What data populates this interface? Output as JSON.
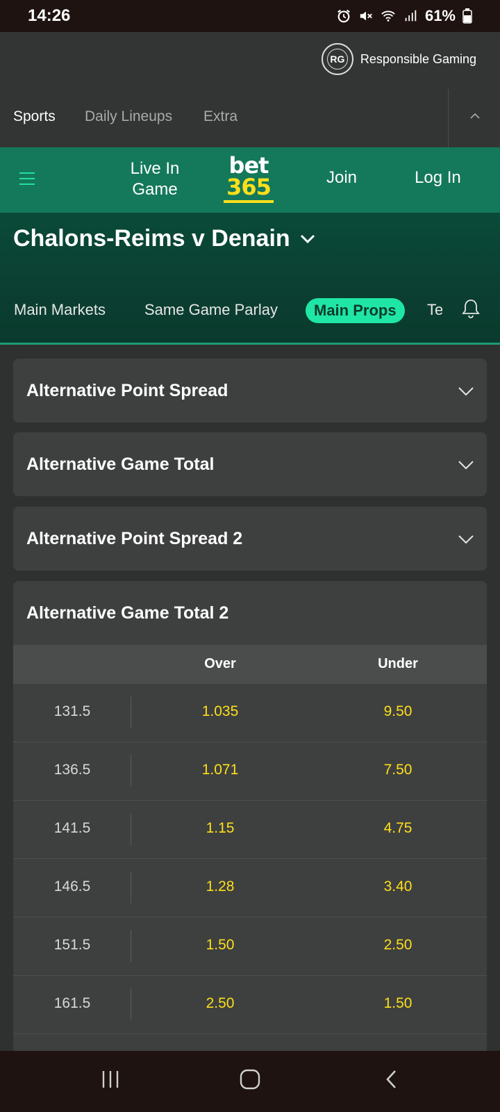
{
  "status_bar": {
    "time": "14:26",
    "battery": "61%",
    "icons": [
      "alarm-icon",
      "mute-icon",
      "wifi-icon",
      "signal-icon",
      "battery-icon"
    ]
  },
  "header": {
    "responsible_gaming": {
      "badge": "RG",
      "label": "Responsible Gaming"
    },
    "nav": [
      "Sports",
      "Daily Lineups",
      "Extra"
    ]
  },
  "green_bar": {
    "live_in_game": "Live In Game",
    "logo_top": "bet",
    "logo_bottom": "365",
    "join": "Join",
    "login": "Log In"
  },
  "match": {
    "title": "Chalons-Reims v Denain",
    "tabs": [
      "Main Markets",
      "Same Game Parlay",
      "Main Props",
      "Te"
    ],
    "active_tab": "Main Props"
  },
  "markets": [
    {
      "title": "Alternative Point Spread",
      "expanded": false
    },
    {
      "title": "Alternative Game Total",
      "expanded": false
    },
    {
      "title": "Alternative Point Spread 2",
      "expanded": false
    },
    {
      "title": "Alternative Game Total 2",
      "expanded": true
    }
  ],
  "total_table": {
    "headers": [
      "Over",
      "Under"
    ],
    "rows": [
      {
        "line": "131.5",
        "over": "1.035",
        "under": "9.50"
      },
      {
        "line": "136.5",
        "over": "1.071",
        "under": "7.50"
      },
      {
        "line": "141.5",
        "over": "1.15",
        "under": "4.75"
      },
      {
        "line": "146.5",
        "over": "1.28",
        "under": "3.40"
      },
      {
        "line": "151.5",
        "over": "1.50",
        "under": "2.50"
      },
      {
        "line": "161.5",
        "over": "2.50",
        "under": "1.50"
      }
    ]
  },
  "colors": {
    "accent": "#1fe6a5",
    "brand_green": "#14795a",
    "odds": "#ffdf1b"
  }
}
